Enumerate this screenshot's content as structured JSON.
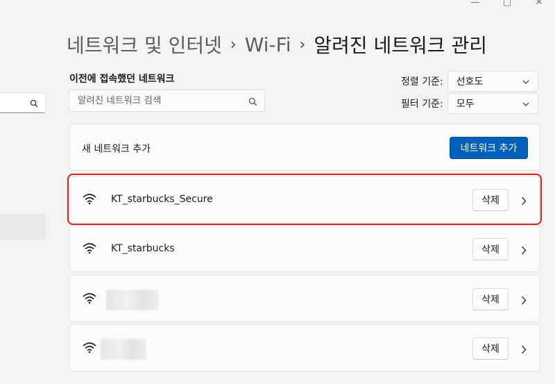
{
  "window": {
    "minimize": "—",
    "maximize": "□",
    "close": "✕"
  },
  "breadcrumb": {
    "items": [
      "네트워크 및 인터넷",
      "Wi-Fi",
      "알려진 네트워크 관리"
    ],
    "separator": "›"
  },
  "section": {
    "title": "이전에 접속했던 네트워크"
  },
  "search": {
    "placeholder": "알려진 네트워크 검색",
    "icon": "search-icon"
  },
  "sort": {
    "label": "정렬 기준:",
    "value": "선호도"
  },
  "filter": {
    "label": "필터 기준:",
    "value": "모두"
  },
  "add_network": {
    "label": "새 네트워크 추가",
    "button": "네트워크 추가"
  },
  "networks": [
    {
      "name": "KT_starbucks_Secure",
      "delete_label": "삭제",
      "highlighted": true
    },
    {
      "name": "KT_starbucks",
      "delete_label": "삭제",
      "highlighted": false
    },
    {
      "name": "",
      "delete_label": "삭제",
      "redacted": true
    },
    {
      "name": "",
      "delete_label": "삭제",
      "redacted": true
    }
  ],
  "colors": {
    "accent": "#005fb8",
    "highlight": "#e02020",
    "background": "#f3f3f3"
  }
}
